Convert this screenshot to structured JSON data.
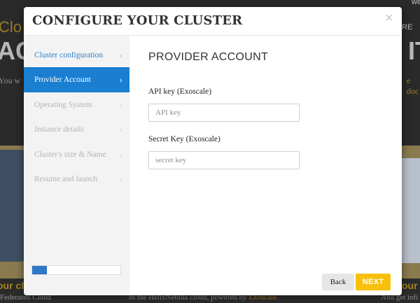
{
  "background": {
    "top_right_fragment": "we",
    "hero_left_word": "Clo",
    "hero_big_left": "AG",
    "hero_big_right": "IT",
    "hero_right_small": "RE",
    "intro_fragment": "You w",
    "docs_fragment": "e doc",
    "card_title_left": "our cl",
    "card_title_right": "our",
    "footer_left": "Federated Cloud",
    "footer_middle_prefix": "In the HelixNebula cloud, powered by ",
    "footer_middle_link": "Exoscale.",
    "footer_right": "And get infi"
  },
  "modal": {
    "title": "CONFIGURE YOUR CLUSTER",
    "close_icon": "×",
    "steps": [
      {
        "label": "Cluster configuration",
        "state": "done"
      },
      {
        "label": "Provider Account",
        "state": "active"
      },
      {
        "label": "Operating System",
        "state": "pending"
      },
      {
        "label": "Instance details",
        "state": "pending"
      },
      {
        "label": "Cluster's size & Name",
        "state": "pending"
      },
      {
        "label": "Resume and launch",
        "state": "pending"
      }
    ],
    "step_chevron": "›",
    "progress_fraction": 0.17,
    "content": {
      "section_title": "PROVIDER ACCOUNT",
      "api_key_label": "API key (Exoscale)",
      "api_key_placeholder": "API key",
      "api_key_value": "",
      "secret_key_label": "Secret Key (Exoscale)",
      "secret_key_placeholder": "secret key",
      "secret_key_value": ""
    },
    "buttons": {
      "back": "Back",
      "next": "NEXT"
    }
  },
  "colors": {
    "accent_blue": "#1a7fd1",
    "next_yellow": "#f8c00c",
    "done_step_blue": "#2f80c6"
  }
}
